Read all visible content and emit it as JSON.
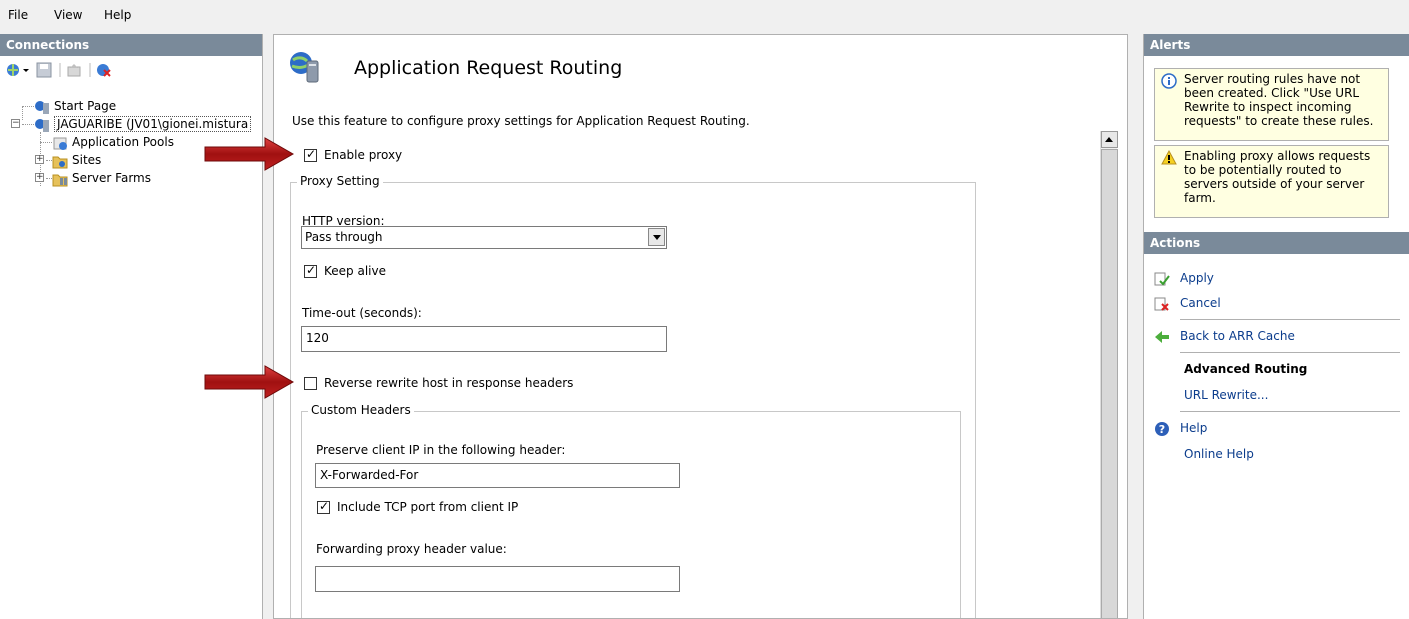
{
  "menu": {
    "file": "File",
    "view": "View",
    "help": "Help"
  },
  "connections": {
    "header": "Connections",
    "tree": {
      "start_page": "Start Page",
      "server": "JAGUARIBE (JV01\\gionei.mistura",
      "app_pools": "Application Pools",
      "sites": "Sites",
      "server_farms": "Server Farms"
    }
  },
  "main": {
    "title": "Application Request Routing",
    "description": "Use this feature to configure proxy settings for Application Request Routing.",
    "enable_proxy": {
      "label": "Enable proxy",
      "checked": true
    },
    "proxy_setting": {
      "title": "Proxy Setting",
      "http_version_label": "HTTP version:",
      "http_version_value": "Pass through",
      "keep_alive": {
        "label": "Keep alive",
        "checked": true
      },
      "timeout_label": "Time-out (seconds):",
      "timeout_value": "120",
      "reverse_rewrite": {
        "label": "Reverse rewrite host in response headers",
        "checked": false
      },
      "custom_headers": {
        "title": "Custom Headers",
        "preserve_ip_label": "Preserve client IP in the following header:",
        "preserve_ip_value": "X-Forwarded-For",
        "include_tcp": {
          "label": "Include TCP port from client IP",
          "checked": true
        },
        "forwarding_label": "Forwarding proxy header value:",
        "forwarding_value": ""
      }
    }
  },
  "alerts": {
    "header": "Alerts",
    "items": [
      {
        "icon": "info-icon",
        "text": "Server routing rules have not been created. Click \"Use URL Rewrite to inspect incoming requests\" to create these rules."
      },
      {
        "icon": "warning-icon",
        "text": "Enabling proxy allows requests to be potentially routed to servers outside of your server farm."
      }
    ]
  },
  "actions": {
    "header": "Actions",
    "apply": "Apply",
    "cancel": "Cancel",
    "back": "Back to ARR Cache",
    "advanced_routing": "Advanced Routing",
    "url_rewrite": "URL Rewrite...",
    "help": "Help",
    "online_help": "Online Help"
  },
  "colors": {
    "pane_header": "#7a8a9a",
    "alert_bg": "#ffffe1",
    "link": "#0b3c8c",
    "arrow": "#b22222"
  }
}
